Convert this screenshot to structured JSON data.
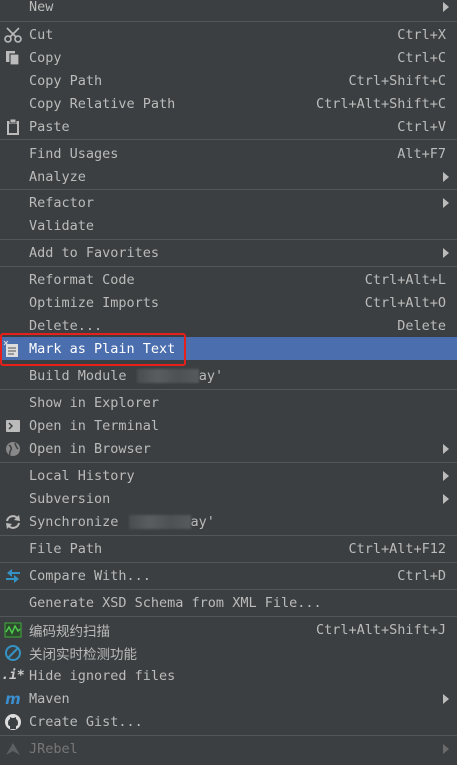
{
  "menu": {
    "new": {
      "label": "New"
    },
    "cut": {
      "label": "Cut",
      "shortcut": "Ctrl+X",
      "icon": "scissors-icon"
    },
    "copy": {
      "label": "Copy",
      "shortcut": "Ctrl+C",
      "icon": "copy-icon"
    },
    "copy_path": {
      "label": "Copy Path",
      "shortcut": "Ctrl+Shift+C"
    },
    "copy_relative_path": {
      "label": "Copy Relative Path",
      "shortcut": "Ctrl+Alt+Shift+C"
    },
    "paste": {
      "label": "Paste",
      "shortcut": "Ctrl+V",
      "icon": "clipboard-icon"
    },
    "find_usages": {
      "label": "Find Usages",
      "shortcut": "Alt+F7"
    },
    "analyze": {
      "label": "Analyze"
    },
    "refactor": {
      "label": "Refactor"
    },
    "validate": {
      "label": "Validate"
    },
    "add_to_favorites": {
      "label": "Add to Favorites"
    },
    "reformat_code": {
      "label": "Reformat Code",
      "shortcut": "Ctrl+Alt+L"
    },
    "optimize_imports": {
      "label": "Optimize Imports",
      "shortcut": "Ctrl+Alt+O"
    },
    "delete": {
      "label": "Delete...",
      "shortcut": "Delete"
    },
    "mark_plain_text": {
      "label": "Mark as Plain Text",
      "icon": "plain-text-file-icon"
    },
    "build_module": {
      "label": "Build Module",
      "suffix": "ay'"
    },
    "show_in_explorer": {
      "label": "Show in Explorer"
    },
    "open_in_terminal": {
      "label": "Open in Terminal",
      "icon": "terminal-icon"
    },
    "open_in_browser": {
      "label": "Open in Browser",
      "icon": "globe-icon"
    },
    "local_history": {
      "label": "Local History"
    },
    "subversion": {
      "label": "Subversion"
    },
    "synchronize": {
      "label": "Synchronize",
      "suffix": "ay'",
      "icon": "sync-icon"
    },
    "file_path": {
      "label": "File Path",
      "shortcut": "Ctrl+Alt+F12"
    },
    "compare_with": {
      "label": "Compare With...",
      "shortcut": "Ctrl+D",
      "icon": "compare-arrows-icon"
    },
    "generate_xsd": {
      "label": "Generate XSD Schema from XML File..."
    },
    "code_scan": {
      "label": "编码规约扫描",
      "shortcut": "Ctrl+Alt+Shift+J",
      "icon": "scan-icon"
    },
    "close_realtime": {
      "label": "关闭实时检测功能",
      "icon": "forbidden-icon"
    },
    "hide_ignored": {
      "label": "Hide ignored files",
      "icon": "ignore-icon"
    },
    "maven": {
      "label": "Maven",
      "icon": "maven-icon"
    },
    "create_gist": {
      "label": "Create Gist...",
      "icon": "github-icon"
    },
    "jrebel": {
      "label": "JRebel",
      "icon": "jrebel-icon"
    }
  },
  "colors": {
    "background": "#3c3f41",
    "selection": "#4b6eaf",
    "highlight_box": "#e8201c",
    "separator": "#515658"
  }
}
